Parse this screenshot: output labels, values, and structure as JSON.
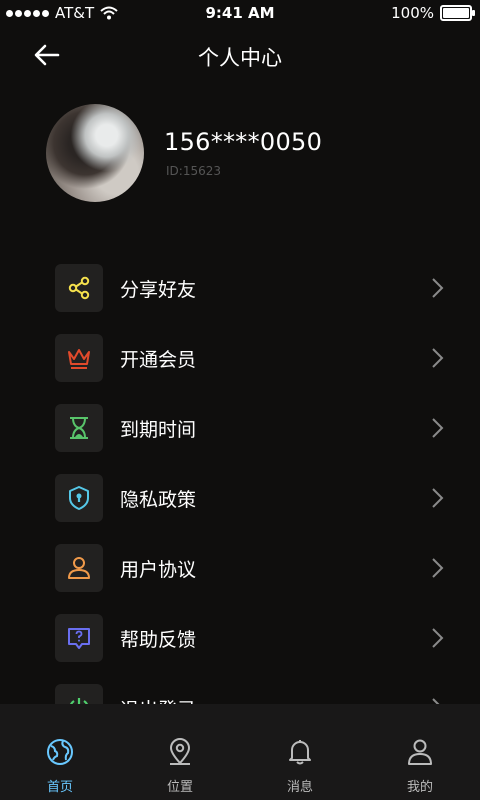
{
  "status_bar": {
    "carrier": "AT&T",
    "time": "9:41 AM",
    "battery": "100%",
    "battery_level": 1.0
  },
  "header": {
    "title": "个人中心"
  },
  "profile": {
    "phone": "156****0050",
    "id": "ID:15623"
  },
  "menu": [
    {
      "label": "分享好友",
      "icon": "share-icon",
      "color": "#f4e04d"
    },
    {
      "label": "开通会员",
      "icon": "crown-icon",
      "color": "#e24a2b"
    },
    {
      "label": "到期时间",
      "icon": "hourglass-icon",
      "color": "#58c46a"
    },
    {
      "label": "隐私政策",
      "icon": "shield-lock-icon",
      "color": "#55c8e8"
    },
    {
      "label": "用户协议",
      "icon": "user-icon",
      "color": "#f09a4a"
    },
    {
      "label": "帮助反馈",
      "icon": "help-chat-icon",
      "color": "#6a6ff0"
    },
    {
      "label": "退出登录",
      "icon": "power-icon",
      "color": "#4fcf6d"
    }
  ],
  "tabbar": [
    {
      "label": "首页",
      "icon": "globe-icon",
      "active": true
    },
    {
      "label": "位置",
      "icon": "location-icon",
      "active": false
    },
    {
      "label": "消息",
      "icon": "bell-icon",
      "active": false
    },
    {
      "label": "我的",
      "icon": "person-icon",
      "active": false
    }
  ],
  "colors": {
    "background": "#0f0e0d",
    "tab_active": "#69c8ff"
  }
}
